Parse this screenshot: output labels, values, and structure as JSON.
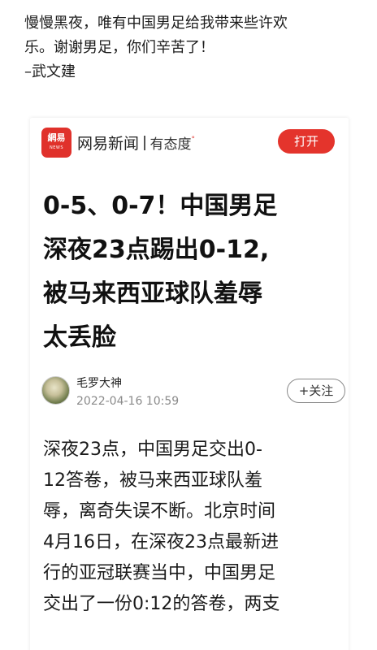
{
  "post": {
    "lines": [
      "慢慢黑夜，唯有中国男足给我带来些许欢",
      "乐。谢谢男足，你们辛苦了！",
      "–武文建"
    ]
  },
  "app_bar": {
    "logo_top": "網易",
    "logo_bottom": "NEWS",
    "brand": "网易新闻",
    "brand_sub": "有态度",
    "brand_deg": "°",
    "open_label": "打开",
    "brand_color": "#e0312b"
  },
  "article": {
    "headline_lines": [
      "0-5、0-7！中国男足",
      "深夜23点踢出0-12,",
      "被马来西亚球队羞辱",
      "太丢脸"
    ],
    "author": "毛罗大神",
    "date": "2022-04-16 10:59",
    "follow_label": "+关注",
    "body_lines": [
      "深夜23点，中国男足交出0-",
      "12答卷，被马来西亚球队羞",
      "辱，离奇失误不断。北京时间",
      "4月16日，在深夜23点最新进",
      "行的亚冠联赛当中，中国男足",
      "交出了一份0:12的答卷，两支"
    ]
  }
}
